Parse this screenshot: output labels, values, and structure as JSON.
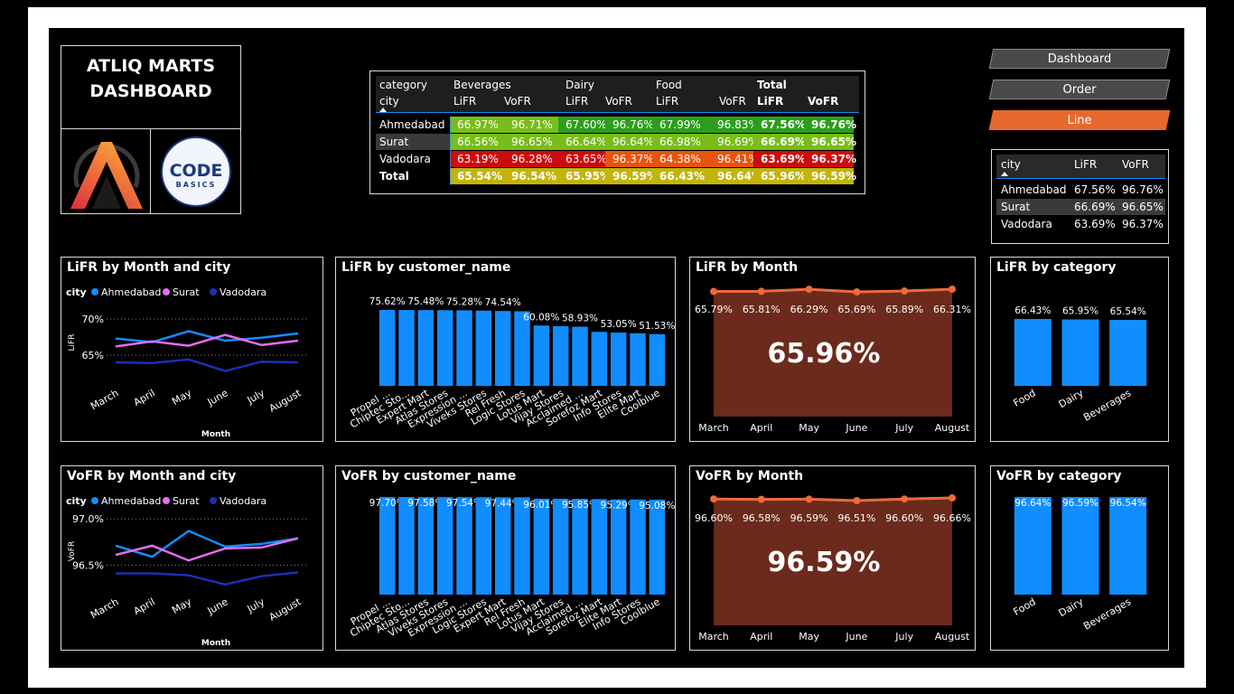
{
  "title_line1": "ATLIQ MARTS",
  "title_line2": "DASHBOARD",
  "logo_text_main": "CODE",
  "logo_text_sub": "BASICS",
  "nav": [
    {
      "label": "Dashboard",
      "active": false
    },
    {
      "label": "Order",
      "active": false
    },
    {
      "label": "Line",
      "active": true
    }
  ],
  "colors": {
    "accent": "#e8692e",
    "bar_blue": "#118dff",
    "ahmedabad": "#118dff",
    "surat": "#e66cf3",
    "vadodara": "#1c2fb3",
    "area_fill": "#6b2a1c",
    "line_orange": "#ee6a3a",
    "green": "#2d9e1c",
    "light_green": "#78bd19",
    "red": "#cc0c0c",
    "orange": "#e8530f",
    "yellow": "#c2b40a"
  },
  "matrix": {
    "row_header_top": "category",
    "row_header_bottom": "city",
    "groups": [
      "Beverages",
      "Dairy",
      "Food",
      "Total"
    ],
    "subs": [
      "LiFR",
      "VoFR"
    ],
    "rows": [
      {
        "city": "Ahmedabad",
        "values": [
          "66.97%",
          "96.71%",
          "67.60%",
          "96.76%",
          "67.99%",
          "96.83%",
          "67.56%",
          "96.76%"
        ]
      },
      {
        "city": "Surat",
        "values": [
          "66.56%",
          "96.65%",
          "66.64%",
          "96.64%",
          "66.98%",
          "96.69%",
          "66.69%",
          "96.65%"
        ]
      },
      {
        "city": "Vadodara",
        "values": [
          "63.19%",
          "96.28%",
          "63.65%",
          "96.37%",
          "64.38%",
          "96.41%",
          "63.69%",
          "96.37%"
        ]
      }
    ],
    "total_label": "Total",
    "total_values": [
      "65.54%",
      "96.54%",
      "65.95%",
      "96.59%",
      "66.43%",
      "96.64%",
      "65.96%",
      "96.59%"
    ]
  },
  "city_table": {
    "headers": [
      "city",
      "LiFR",
      "VoFR"
    ],
    "rows": [
      [
        "Ahmedabad",
        "67.56%",
        "96.76%"
      ],
      [
        "Surat",
        "66.69%",
        "96.65%"
      ],
      [
        "Vadodara",
        "63.69%",
        "96.37%"
      ]
    ]
  },
  "chart_data": [
    {
      "id": "lifr_month_city",
      "type": "line",
      "title": "LiFR by Month and city",
      "legend_title": "city",
      "legend_placement": "top-left",
      "xlabel": "Month",
      "ylabel": "LiFR",
      "categories": [
        "March",
        "April",
        "May",
        "June",
        "July",
        "August"
      ],
      "yticks": [
        "70%",
        "65%"
      ],
      "ytick_values": [
        70,
        65
      ],
      "ylim": [
        61,
        72.5
      ],
      "grid": true,
      "series": [
        {
          "name": "Ahmedabad",
          "values": [
            67.3,
            66.8,
            68.3,
            67.0,
            67.4,
            68.0
          ]
        },
        {
          "name": "Surat",
          "values": [
            66.2,
            66.9,
            66.3,
            67.8,
            66.4,
            67.0
          ]
        },
        {
          "name": "Vadodara",
          "values": [
            64.0,
            63.9,
            64.4,
            62.8,
            64.1,
            64.0
          ]
        }
      ]
    },
    {
      "id": "lifr_customer",
      "type": "bar",
      "title": "LiFR by customer_name",
      "categories": [
        "Propel ...",
        "Chiptec Sto...",
        "Expert Mart",
        "Atlas Stores",
        "Expression ...",
        "Viveks Stores",
        "Rel Fresh",
        "Logic Stores",
        "Lotus Mart",
        "Vijay Stores",
        "Acclaimed ...",
        "Sorefoz Mart",
        "Info Stores",
        "Elite Mart",
        "Coolblue"
      ],
      "values": [
        75.62,
        75.55,
        75.48,
        75.4,
        75.28,
        74.95,
        74.54,
        74.3,
        60.08,
        59.4,
        58.93,
        53.8,
        53.05,
        52.4,
        51.53
      ],
      "labels": [
        "75.62%",
        "",
        "75.48%",
        "",
        "75.28%",
        "",
        "74.54%",
        "",
        "60.08%",
        "",
        "58.93%",
        "",
        "53.05%",
        "",
        "51.53%"
      ],
      "ylim": [
        0,
        75.62
      ]
    },
    {
      "id": "lifr_month",
      "type": "area",
      "title": "LiFR by Month",
      "categories": [
        "March",
        "April",
        "May",
        "June",
        "July",
        "August"
      ],
      "values": [
        65.79,
        65.81,
        66.29,
        65.69,
        65.89,
        66.31
      ],
      "labels": [
        "65.79%",
        "65.81%",
        "66.29%",
        "65.69%",
        "65.89%",
        "66.31%"
      ],
      "kpi": "65.96%"
    },
    {
      "id": "lifr_category",
      "type": "bar",
      "title": "LiFR by category",
      "categories": [
        "Food",
        "Dairy",
        "Beverages"
      ],
      "values": [
        66.43,
        65.95,
        65.54
      ],
      "labels": [
        "66.43%",
        "65.95%",
        "65.54%"
      ],
      "ylim": [
        0,
        66.43
      ]
    },
    {
      "id": "vofr_month_city",
      "type": "line",
      "title": "VoFR by Month and city",
      "legend_title": "city",
      "legend_placement": "top-left",
      "xlabel": "Month",
      "ylabel": "VoFR",
      "categories": [
        "March",
        "April",
        "May",
        "June",
        "July",
        "August"
      ],
      "yticks": [
        "97.0%",
        "96.5%"
      ],
      "ytick_values": [
        97.0,
        96.5
      ],
      "ylim": [
        96.2,
        97.1
      ],
      "grid": true,
      "series": [
        {
          "name": "Ahmedabad",
          "values": [
            96.71,
            96.59,
            96.87,
            96.7,
            96.73,
            96.79
          ]
        },
        {
          "name": "Surat",
          "values": [
            96.61,
            96.71,
            96.55,
            96.68,
            96.69,
            96.79
          ]
        },
        {
          "name": "Vadodara",
          "values": [
            96.41,
            96.41,
            96.39,
            96.29,
            96.38,
            96.42
          ]
        }
      ]
    },
    {
      "id": "vofr_customer",
      "type": "bar",
      "title": "VoFR by customer_name",
      "categories": [
        "Propel ...",
        "Chiptec Sto...",
        "Atlas Stores",
        "Viveks Stores",
        "Expression ...",
        "Logic Stores",
        "Expert Mart",
        "Rel Fresh",
        "Lotus Mart",
        "Vijay Stores",
        "Acclaimed ...",
        "Sorefoz Mart",
        "Elite Mart",
        "Info Stores",
        "Coolblue"
      ],
      "values": [
        97.7,
        97.64,
        97.58,
        97.56,
        97.54,
        97.5,
        97.44,
        97.4,
        96.01,
        95.95,
        95.85,
        95.6,
        95.29,
        95.2,
        95.08
      ],
      "labels": [
        "97.70%",
        "",
        "97.58%",
        "",
        "97.54%",
        "",
        "97.44%",
        "",
        "96.01%",
        "",
        "95.85%",
        "",
        "95.29%",
        "",
        "95.08%"
      ],
      "ylim": [
        0,
        97.7
      ]
    },
    {
      "id": "vofr_month",
      "type": "area",
      "title": "VoFR by Month",
      "categories": [
        "March",
        "April",
        "May",
        "June",
        "July",
        "August"
      ],
      "values": [
        96.6,
        96.58,
        96.59,
        96.51,
        96.6,
        96.66
      ],
      "labels": [
        "96.60%",
        "96.58%",
        "96.59%",
        "96.51%",
        "96.60%",
        "96.66%"
      ],
      "kpi": "96.59%"
    },
    {
      "id": "vofr_category",
      "type": "bar",
      "title": "VoFR by category",
      "categories": [
        "Food",
        "Dairy",
        "Beverages"
      ],
      "values": [
        96.64,
        96.59,
        96.54
      ],
      "labels": [
        "96.64%",
        "96.59%",
        "96.54%"
      ],
      "ylim": [
        0,
        96.64
      ]
    }
  ]
}
